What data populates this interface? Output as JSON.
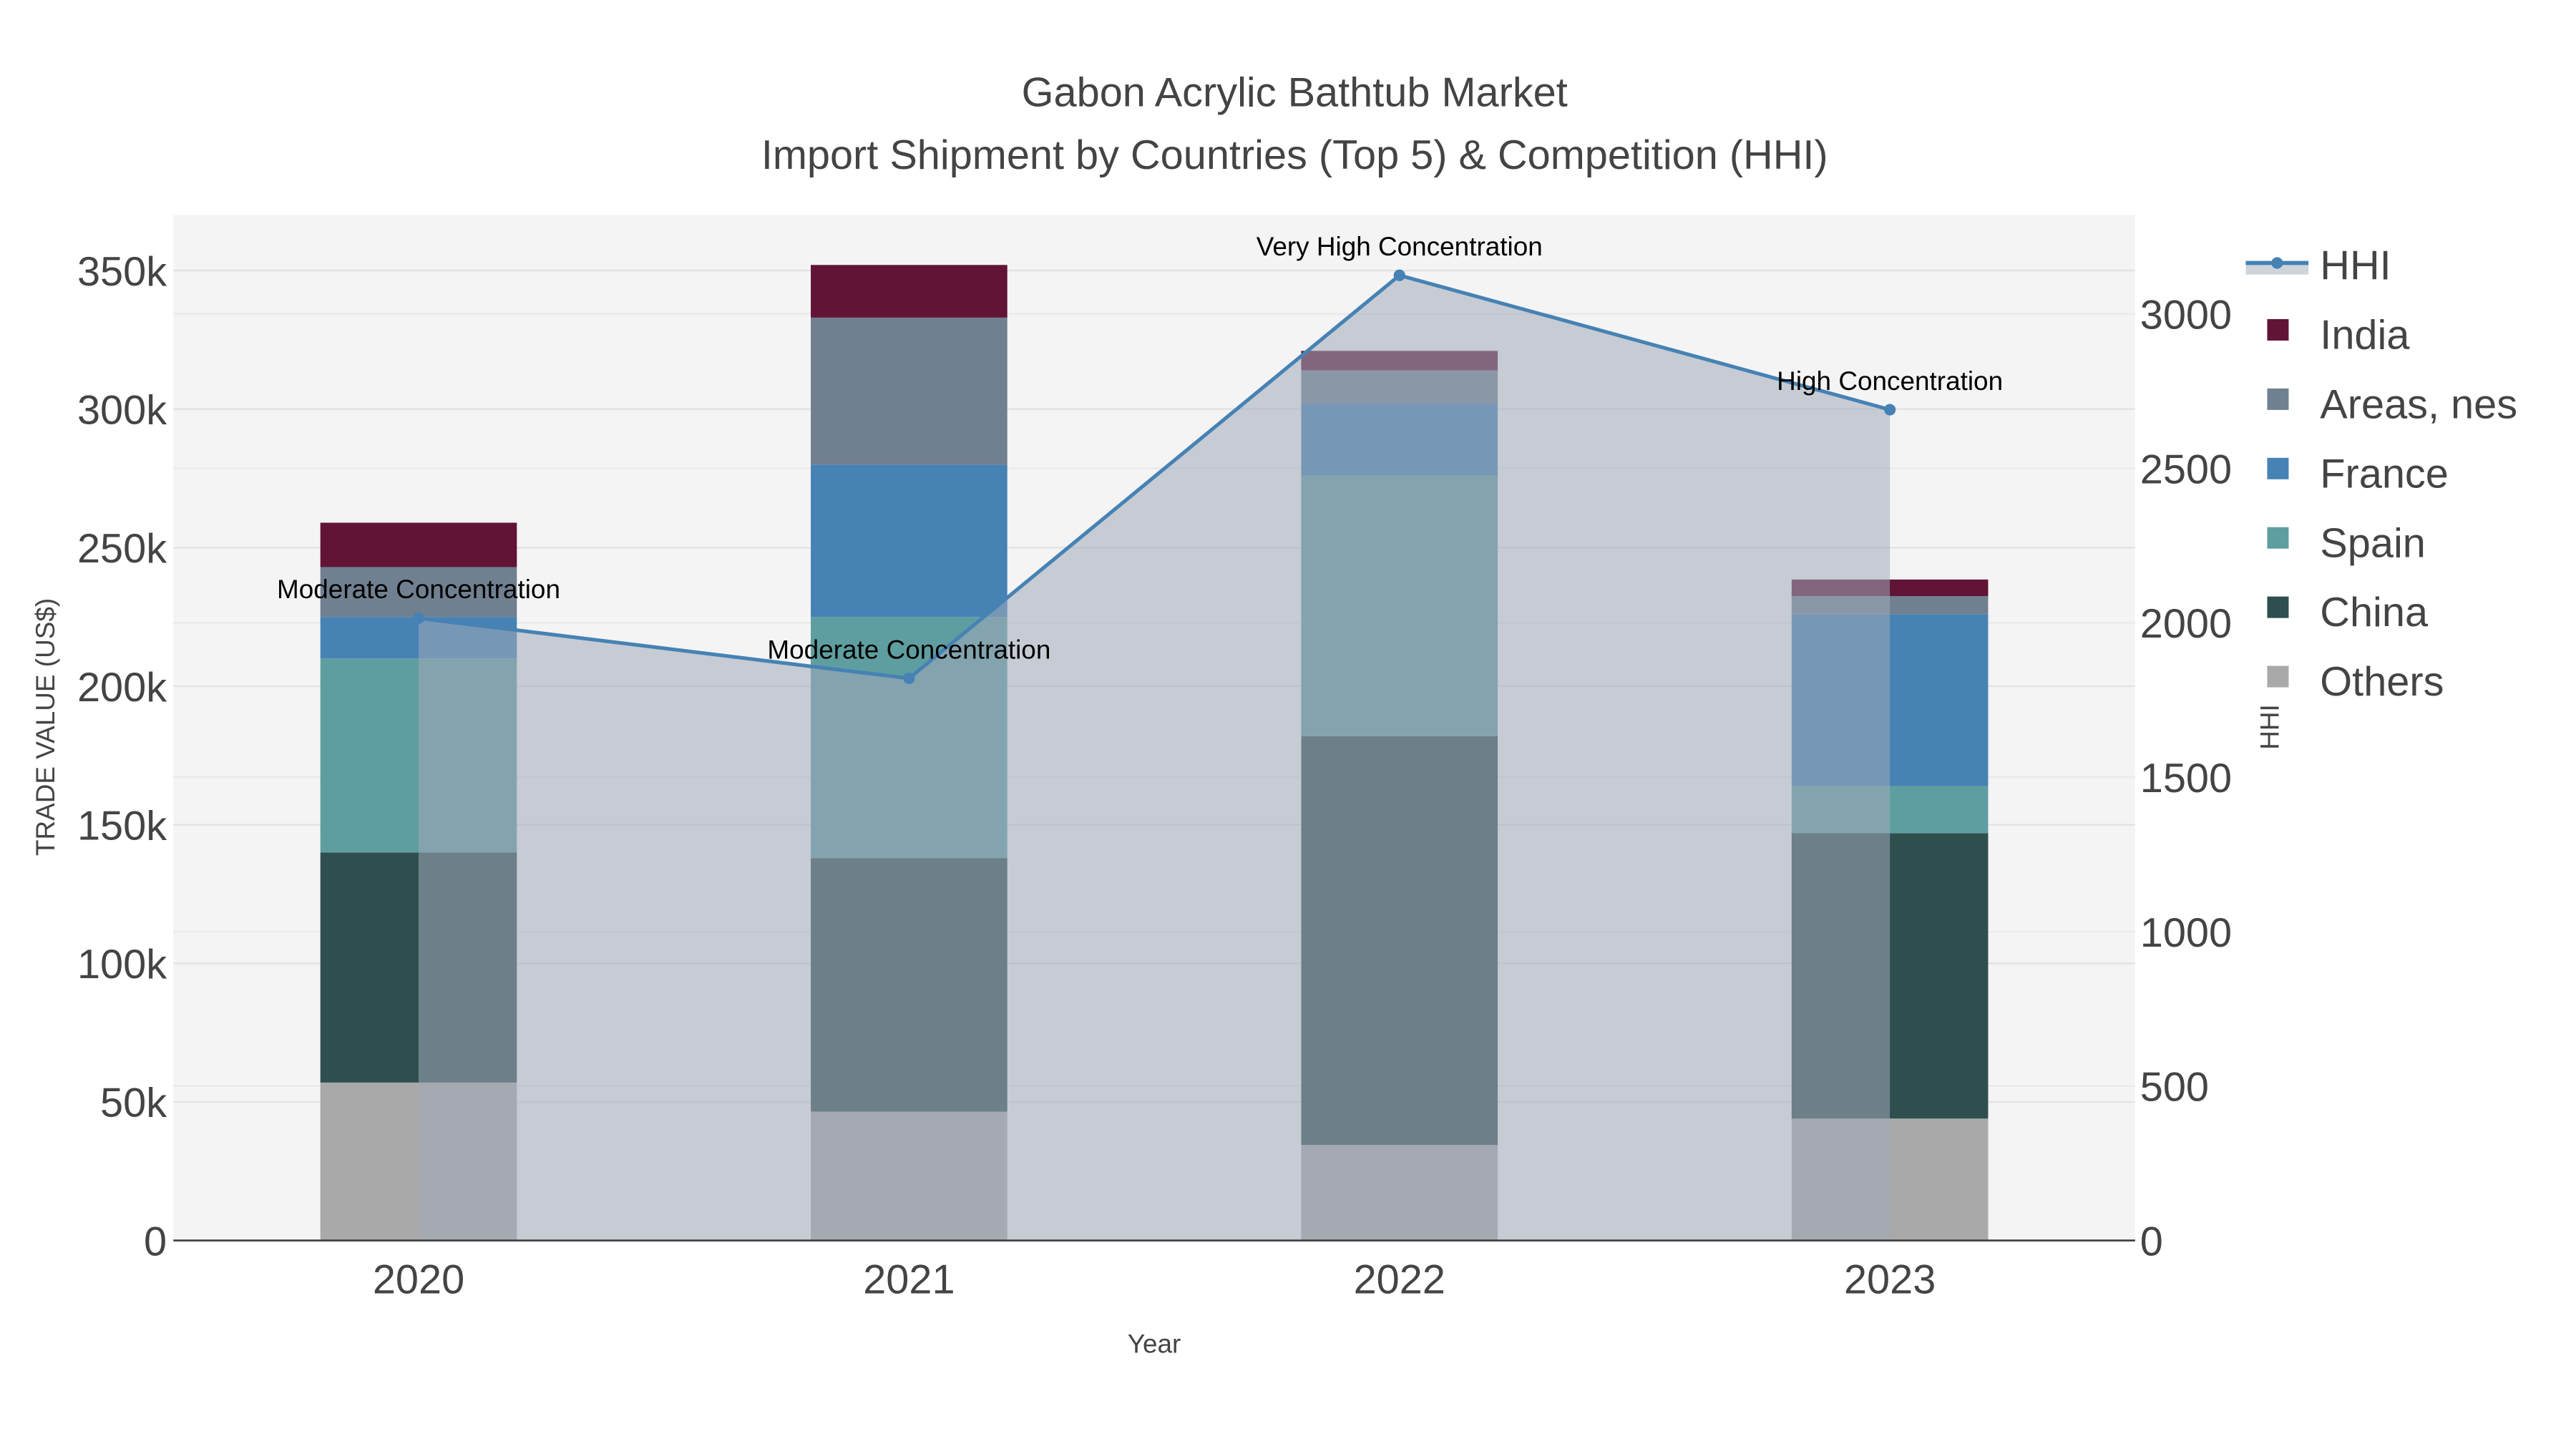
{
  "chart_data": {
    "type": "bar",
    "title": "Gabon Acrylic Bathtub Market",
    "subtitle": "Import Shipment by Countries (Top 5) & Competition (HHI)",
    "xlabel": "Year",
    "ylabel": "TRADE VALUE (US$)",
    "y2label": "HHI",
    "categories": [
      "2020",
      "2021",
      "2022",
      "2023"
    ],
    "ylim": [
      0,
      370000
    ],
    "y2lim": [
      0,
      3320
    ],
    "yticks": [
      0,
      50000,
      100000,
      150000,
      200000,
      250000,
      300000,
      350000
    ],
    "ytick_labels": [
      "0",
      "50k",
      "100k",
      "150k",
      "200k",
      "250k",
      "300k",
      "350k"
    ],
    "y2ticks": [
      0,
      500,
      1000,
      1500,
      2000,
      2500,
      3000
    ],
    "y2tick_labels": [
      "0",
      "500",
      "1000",
      "1500",
      "2000",
      "2500",
      "3000"
    ],
    "grid": true,
    "legend_position": "right",
    "series": [
      {
        "name": "Others",
        "color": "#A9A9A9",
        "values": [
          57000,
          46500,
          34500,
          44000
        ]
      },
      {
        "name": "China",
        "color": "#2F4F4F",
        "values": [
          83000,
          91500,
          147500,
          103000
        ]
      },
      {
        "name": "Spain",
        "color": "#5F9EA0",
        "values": [
          70000,
          87000,
          94000,
          17000
        ]
      },
      {
        "name": "France",
        "color": "#4682B4",
        "values": [
          15000,
          55000,
          26000,
          62000
        ]
      },
      {
        "name": "Areas, nes",
        "color": "#708090",
        "values": [
          18000,
          53000,
          12000,
          6500
        ]
      },
      {
        "name": "India",
        "color": "#611435",
        "values": [
          16000,
          19000,
          7000,
          6000
        ]
      }
    ],
    "hhi": {
      "name": "HHI",
      "color": "#4682B4",
      "values": [
        2015,
        1820,
        3125,
        2690
      ],
      "annotations": [
        "Moderate Concentration",
        "Moderate Concentration",
        "Very High Concentration",
        "High Concentration"
      ]
    },
    "legend_order": [
      "HHI",
      "India",
      "Areas, nes",
      "France",
      "Spain",
      "China",
      "Others"
    ]
  }
}
